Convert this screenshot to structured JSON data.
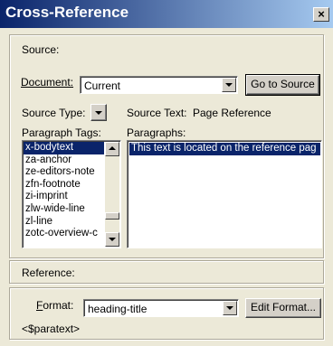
{
  "window": {
    "title": "Cross-Reference",
    "close_glyph": "×"
  },
  "source": {
    "section_label": "Source:",
    "document_label": "Document:",
    "document_value": "Current",
    "go_to_source": "Go to Source",
    "source_type_label": "Source Type:",
    "source_text_label": "Source Text:",
    "source_text_value": "Page  Reference",
    "paragraph_tags_label": "Paragraph Tags:",
    "paragraph_tags": [
      {
        "label": "x-bodytext",
        "selected": true
      },
      {
        "label": "za-anchor",
        "selected": false
      },
      {
        "label": "ze-editors-note",
        "selected": false
      },
      {
        "label": "zfn-footnote",
        "selected": false
      },
      {
        "label": "zi-imprint",
        "selected": false
      },
      {
        "label": "zlw-wide-line",
        "selected": false
      },
      {
        "label": "zl-line",
        "selected": false
      },
      {
        "label": "zotc-overview-c",
        "selected": false
      }
    ],
    "paragraphs_label": "Paragraphs:",
    "paragraphs_selected": "This text is located on the reference pag"
  },
  "reference": {
    "section_label": "Reference:",
    "format_label": "Format:",
    "format_value": "heading-title",
    "edit_format": "Edit Format...",
    "format_string": "<$paratext>"
  }
}
